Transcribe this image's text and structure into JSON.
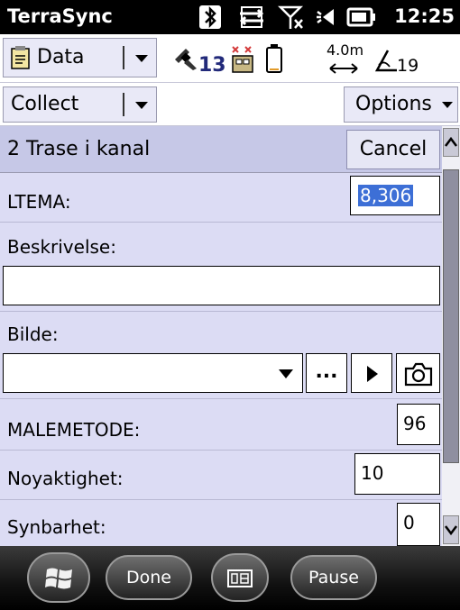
{
  "statusbar": {
    "app_title": "TerraSync",
    "time": "12:25",
    "icons": [
      "bluetooth-icon",
      "connectivity-arrows-icon",
      "no-signal-icon",
      "speaker-icon",
      "battery-icon"
    ]
  },
  "toolbar1": {
    "section_dropdown": {
      "label": "Data",
      "icon": "notepad-icon"
    },
    "satellite_count": "13",
    "accuracy_value": "4.0m",
    "pdop_value": "19",
    "icons": [
      "satellite-icon",
      "gps-receiver-icon",
      "battery-level-icon",
      "accuracy-icon",
      "pdop-icon"
    ]
  },
  "toolbar2": {
    "mode_dropdown": {
      "label": "Collect"
    },
    "options_label": "Options"
  },
  "form": {
    "title": "2 Trase i kanal",
    "cancel_label": "Cancel",
    "fields": {
      "ltema": {
        "label": "LTEMA:",
        "value": "8,306"
      },
      "beskrivelse": {
        "label": "Beskrivelse:",
        "value": ""
      },
      "bilde": {
        "label": "Bilde:",
        "value": "",
        "browse_label": "...",
        "icons": [
          "play-icon",
          "camera-icon"
        ]
      },
      "malemetode": {
        "label": "MALEMETODE:",
        "value": "96"
      },
      "noyaktighet": {
        "label": "Noyaktighet:",
        "value": "10"
      },
      "synbarhet": {
        "label": "Synbarhet:",
        "value": "0"
      }
    }
  },
  "taskbar": {
    "start_icon": "windows-logo-icon",
    "done_label": "Done",
    "keyboard_icon": "keyboard-icon",
    "pause_label": "Pause"
  },
  "colors": {
    "form_background": "#dcdcf4",
    "form_header": "#c6c8e7",
    "selection": "#3d6fd6"
  }
}
